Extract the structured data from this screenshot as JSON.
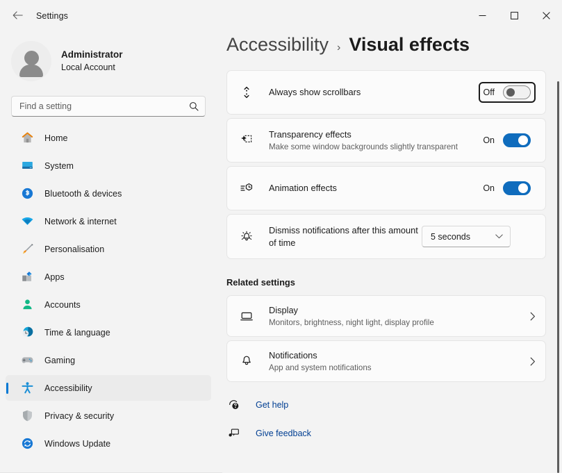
{
  "window": {
    "title": "Settings",
    "back_icon": "arrow-left-icon",
    "minimize_label": "─",
    "maximize_label": "□",
    "close_label": "✕"
  },
  "account": {
    "name": "Administrator",
    "subtitle": "Local Account",
    "avatar_icon": "person-avatar-icon"
  },
  "search": {
    "placeholder": "Find a setting",
    "value": "",
    "icon": "search-icon"
  },
  "sidebar": {
    "items": [
      {
        "label": "Home",
        "icon": "home-icon",
        "selected": false
      },
      {
        "label": "System",
        "icon": "system-icon",
        "selected": false
      },
      {
        "label": "Bluetooth & devices",
        "icon": "bluetooth-icon",
        "selected": false
      },
      {
        "label": "Network & internet",
        "icon": "network-icon",
        "selected": false
      },
      {
        "label": "Personalisation",
        "icon": "brush-icon",
        "selected": false
      },
      {
        "label": "Apps",
        "icon": "apps-icon",
        "selected": false
      },
      {
        "label": "Accounts",
        "icon": "accounts-icon",
        "selected": false
      },
      {
        "label": "Time & language",
        "icon": "clock-icon",
        "selected": false
      },
      {
        "label": "Gaming",
        "icon": "gamepad-icon",
        "selected": false
      },
      {
        "label": "Accessibility",
        "icon": "accessibility-icon",
        "selected": true
      },
      {
        "label": "Privacy & security",
        "icon": "shield-icon",
        "selected": false
      },
      {
        "label": "Windows Update",
        "icon": "update-icon",
        "selected": false
      }
    ]
  },
  "breadcrumb": {
    "parent": "Accessibility",
    "separator": "›",
    "current": "Visual effects"
  },
  "settings": [
    {
      "title": "Always show scrollbars",
      "subtitle": "",
      "icon": "scrollbar-icon",
      "control": "toggle",
      "state_label": "Off",
      "state_on": false,
      "focused": true
    },
    {
      "title": "Transparency effects",
      "subtitle": "Make some window backgrounds slightly transparent",
      "icon": "sparkle-dashed-icon",
      "control": "toggle",
      "state_label": "On",
      "state_on": true,
      "focused": false
    },
    {
      "title": "Animation effects",
      "subtitle": "",
      "icon": "animation-icon",
      "control": "toggle",
      "state_label": "On",
      "state_on": true,
      "focused": false
    },
    {
      "title": "Dismiss notifications after this amount of time",
      "subtitle": "",
      "icon": "bell-alert-icon",
      "control": "dropdown",
      "state_label": "5 seconds",
      "dropdown_icon": "chevron-down-icon"
    }
  ],
  "related": {
    "heading": "Related settings",
    "items": [
      {
        "title": "Display",
        "subtitle": "Monitors, brightness, night light, display profile",
        "icon": "monitor-icon",
        "chevron": "chevron-right-icon"
      },
      {
        "title": "Notifications",
        "subtitle": "App and system notifications",
        "icon": "bell-icon",
        "chevron": "chevron-right-icon"
      }
    ]
  },
  "footer_links": [
    {
      "label": "Get help",
      "icon": "help-icon"
    },
    {
      "label": "Give feedback",
      "icon": "feedback-icon"
    }
  ],
  "colors": {
    "accent": "#0078d4",
    "toggle_on": "#0f6cbd",
    "link": "#003e92",
    "page_bg": "#f3f3f3",
    "card_bg": "#fbfbfb"
  }
}
